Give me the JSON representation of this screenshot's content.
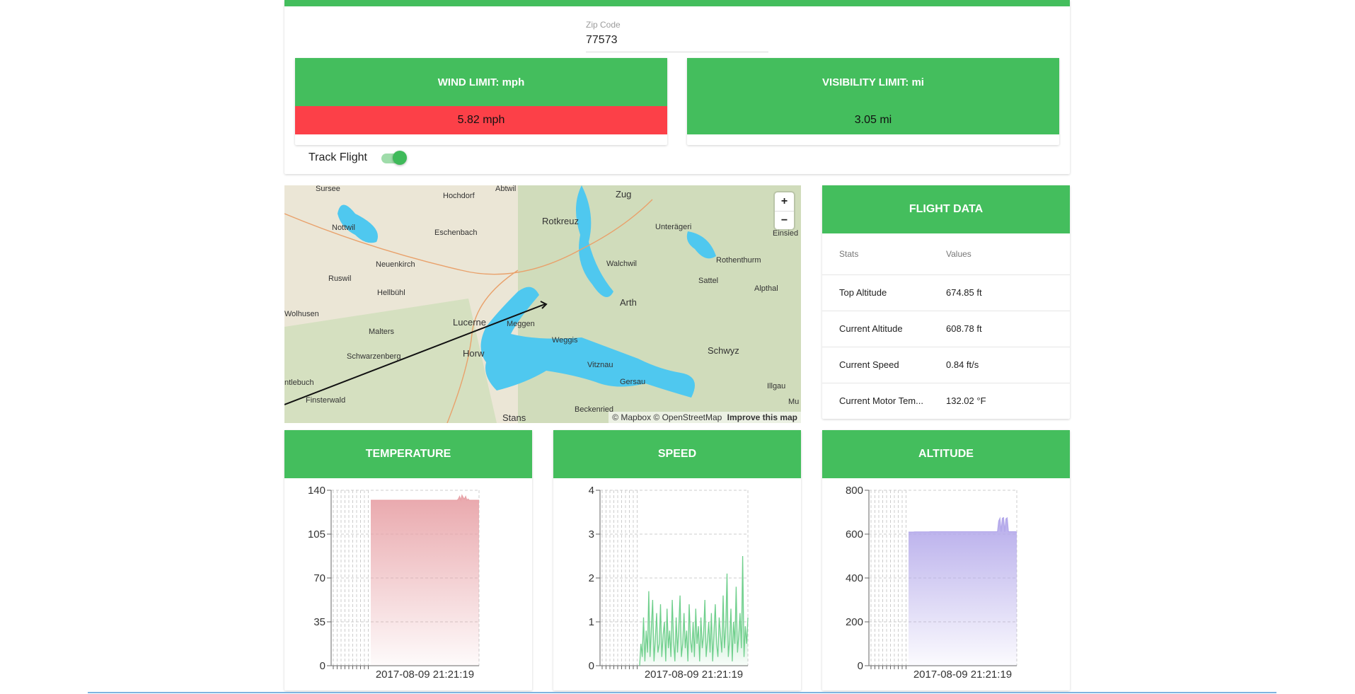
{
  "zip": {
    "label": "Zip Code",
    "value": "77573"
  },
  "wind": {
    "title": "WIND LIMIT: mph",
    "value": "5.82 mph",
    "status_color": "#fc4048"
  },
  "visibility": {
    "title": "VISIBILITY LIMIT: mi",
    "value": "3.05 mi",
    "status_color": "#44be5d"
  },
  "track": {
    "label": "Track Flight",
    "enabled": true
  },
  "map": {
    "zoom_in": "+",
    "zoom_out": "−",
    "attribution": "© Mapbox © OpenStreetMap",
    "improve": "Improve this map",
    "places": [
      "Sursee",
      "Abtwil",
      "Hochdorf",
      "Zug",
      "Unterägeri",
      "Einsied",
      "Nottwil",
      "Eschenbach",
      "Rotkreuz",
      "Rothenthurm",
      "Neuenkirch",
      "Walchwil",
      "Sattel",
      "Ruswil",
      "Hellbühl",
      "Alpthal",
      "Arth",
      "Wolhusen",
      "Lucerne",
      "Meggen",
      "Malters",
      "Weggis",
      "Schwyz",
      "Schwarzenberg",
      "Horw",
      "Vitznau",
      "Gersau",
      "ntlebuch",
      "Illgau",
      "Finsterwald",
      "Beckenried",
      "Stans",
      "Mu"
    ]
  },
  "flight_data": {
    "title": "FLIGHT DATA",
    "col_stats": "Stats",
    "col_values": "Values",
    "rows": [
      {
        "stat": "Top Altitude",
        "value": "674.85 ft"
      },
      {
        "stat": "Current Altitude",
        "value": "608.78 ft"
      },
      {
        "stat": "Current Speed",
        "value": "0.84 ft/s"
      },
      {
        "stat": "Current Motor Tem...",
        "value": "132.02 °F"
      }
    ]
  },
  "chart_data": [
    {
      "type": "area",
      "title": "TEMPERATURE",
      "color": "#e8a3a8",
      "ylim": [
        0,
        140
      ],
      "yticks": [
        0,
        35,
        70,
        105,
        140
      ],
      "xtick": "2017-08-09 21:21:19",
      "values": [
        132,
        132,
        132,
        132,
        132,
        132,
        132,
        132,
        132,
        132,
        132,
        132,
        132,
        132,
        132,
        132,
        132,
        132,
        132,
        132,
        132,
        132,
        132,
        132,
        132,
        132,
        132,
        132,
        132,
        132,
        132,
        132,
        132,
        132,
        132,
        132,
        132,
        132,
        132,
        132,
        132,
        132,
        132,
        132,
        132,
        132,
        132,
        132,
        132,
        132,
        132,
        132,
        132,
        132,
        132,
        132,
        132,
        132,
        132,
        132,
        132,
        132,
        132,
        132,
        132,
        132,
        132,
        132,
        132,
        132,
        132,
        132,
        133,
        135,
        132,
        136,
        134,
        133,
        135,
        132,
        133,
        132,
        132,
        132,
        132,
        132,
        132,
        132,
        132,
        132
      ]
    },
    {
      "type": "area",
      "title": "SPEED",
      "color": "#6fcf8c",
      "ylim": [
        0,
        4
      ],
      "yticks": [
        0,
        1,
        2,
        3,
        4
      ],
      "xtick": "2017-08-09 21:21:19",
      "values": [
        0,
        0.5,
        0.2,
        1.1,
        0.1,
        0.8,
        0.3,
        1.7,
        0.2,
        0.9,
        1.5,
        0.1,
        0.6,
        1.2,
        0.3,
        0.5,
        1.4,
        0.2,
        0.7,
        1.0,
        0.1,
        1.3,
        0.4,
        0.8,
        0.2,
        1.5,
        0.6,
        0.1,
        1.1,
        0.3,
        0.9,
        1.6,
        0.2,
        0.5,
        1.2,
        0.4,
        0.8,
        0.1,
        1.4,
        0.6,
        0.3,
        1.0,
        0.2,
        1.3,
        0.5,
        0.9,
        0.1,
        1.1,
        0.4,
        0.7,
        1.5,
        0.2,
        0.6,
        1.0,
        0.3,
        1.2,
        0.1,
        0.8,
        1.4,
        0.5,
        0.2,
        1.1,
        0.7,
        0.3,
        1.6,
        0.4,
        0.9,
        2.1,
        0.2,
        0.6,
        1.3,
        0.1,
        1.0,
        0.5,
        1.8,
        0.3,
        0.7,
        1.2,
        0.4,
        2.5,
        0.2,
        0.9,
        0.5,
        1.1
      ]
    },
    {
      "type": "area",
      "title": "ALTITUDE",
      "color": "#b3a8ea",
      "ylim": [
        0,
        800
      ],
      "yticks": [
        0,
        200,
        400,
        600,
        800
      ],
      "xtick": "2017-08-09 21:21:19",
      "values": [
        609,
        609,
        609,
        609,
        609,
        610,
        610,
        610,
        610,
        610,
        610,
        610,
        610,
        610,
        610,
        610,
        610,
        610,
        611,
        611,
        611,
        611,
        611,
        611,
        611,
        611,
        611,
        611,
        611,
        611,
        611,
        611,
        611,
        611,
        611,
        611,
        611,
        611,
        611,
        611,
        611,
        611,
        611,
        611,
        611,
        611,
        611,
        611,
        611,
        611,
        611,
        611,
        611,
        611,
        611,
        611,
        611,
        611,
        611,
        611,
        611,
        611,
        611,
        611,
        611,
        611,
        611,
        611,
        611,
        611,
        611,
        611,
        611,
        611,
        611,
        660,
        672,
        611,
        672,
        675,
        611,
        670,
        674,
        611,
        611,
        611,
        611,
        611,
        611,
        611,
        609
      ]
    }
  ]
}
